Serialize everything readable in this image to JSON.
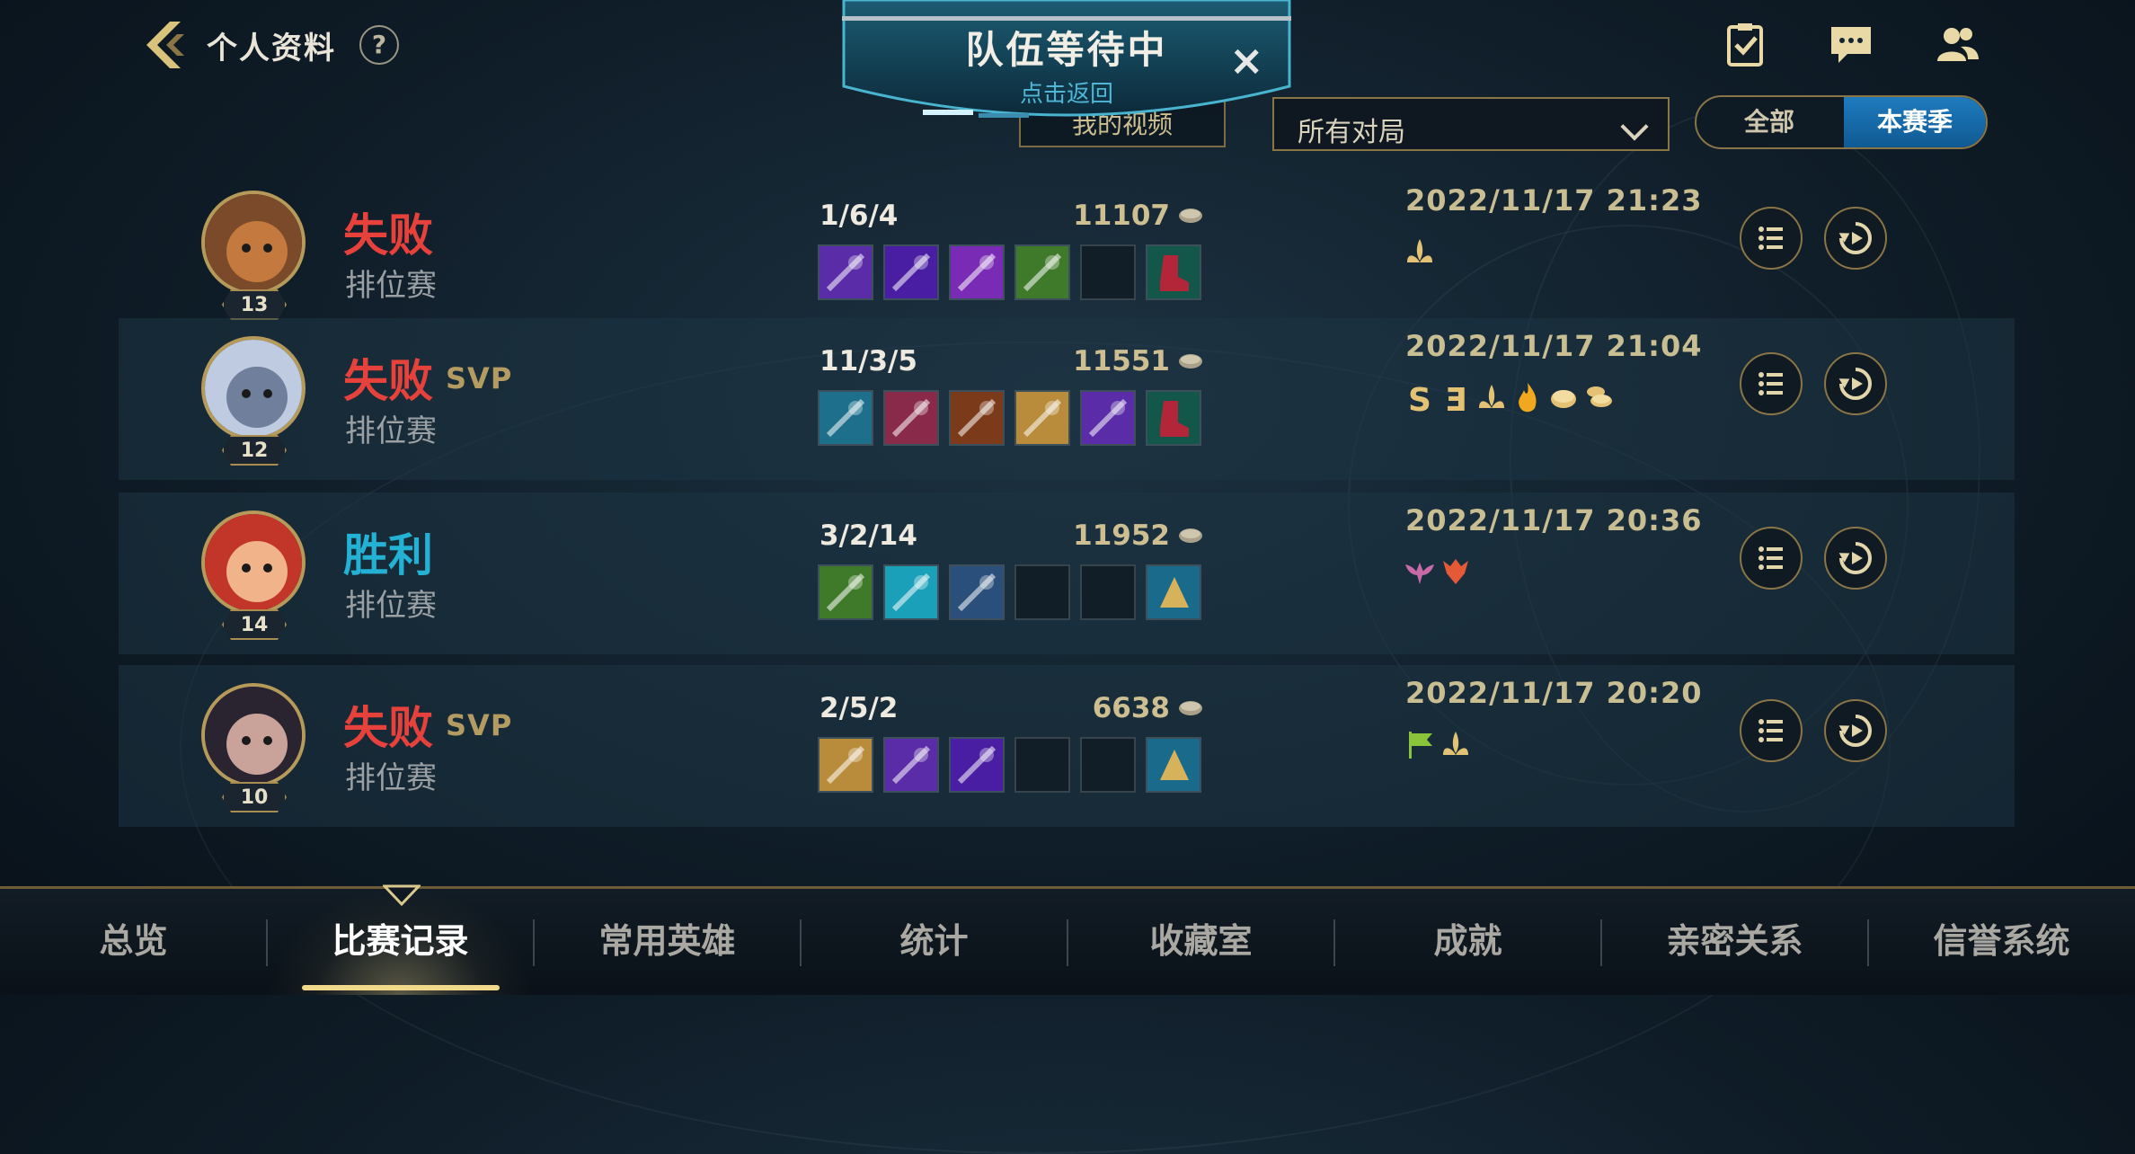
{
  "header": {
    "title": "个人资料",
    "help": "?"
  },
  "queue": {
    "title": "队伍等待中",
    "subtitle": "点击返回",
    "close": "×"
  },
  "filters": {
    "video_label": "我的视频",
    "match_filter": "所有对局",
    "season_options": [
      "全部",
      "本赛季"
    ],
    "season_selected": "本赛季"
  },
  "matches": [
    {
      "result": "失败",
      "result_type": "loss",
      "svp": "",
      "mode": "排位赛",
      "level": "13",
      "kda": "1/6/4",
      "gold": "11107",
      "date": "2022/11/17 21:23",
      "items": [
        "item",
        "item",
        "item",
        "item",
        "empty",
        "boots"
      ],
      "badges": [
        "lotus"
      ]
    },
    {
      "result": "失败",
      "result_type": "loss",
      "svp": "SVP",
      "mode": "排位赛",
      "level": "12",
      "kda": "11/3/5",
      "gold": "11551",
      "date": "2022/11/17 21:04",
      "items": [
        "item",
        "item",
        "item",
        "item",
        "item",
        "boots"
      ],
      "badges": [
        "S",
        "Ǝ",
        "lotus",
        "fire",
        "coin",
        "coins"
      ]
    },
    {
      "result": "胜利",
      "result_type": "win",
      "svp": "",
      "mode": "排位赛",
      "level": "14",
      "kda": "3/2/14",
      "gold": "11952",
      "date": "2022/11/17 20:36",
      "items": [
        "item",
        "item",
        "item",
        "empty",
        "empty",
        "trinket"
      ],
      "badges": [
        "wings",
        "dragon"
      ]
    },
    {
      "result": "失败",
      "result_type": "loss",
      "svp": "SVP",
      "mode": "排位赛",
      "level": "10",
      "kda": "2/5/2",
      "gold": "6638",
      "date": "2022/11/17 20:20",
      "items": [
        "item",
        "item",
        "item",
        "empty",
        "empty",
        "trinket"
      ],
      "badges": [
        "flag",
        "lotus"
      ]
    }
  ],
  "nav": {
    "tabs": [
      "总览",
      "比赛记录",
      "常用英雄",
      "统计",
      "收藏室",
      "成就",
      "亲密关系",
      "信誉系统"
    ],
    "active": "比赛记录"
  },
  "colors": {
    "loss": "#e7413b",
    "win": "#23b1d4",
    "gold_accent": "#b69a5a",
    "season_active": "#1f7bbd"
  }
}
